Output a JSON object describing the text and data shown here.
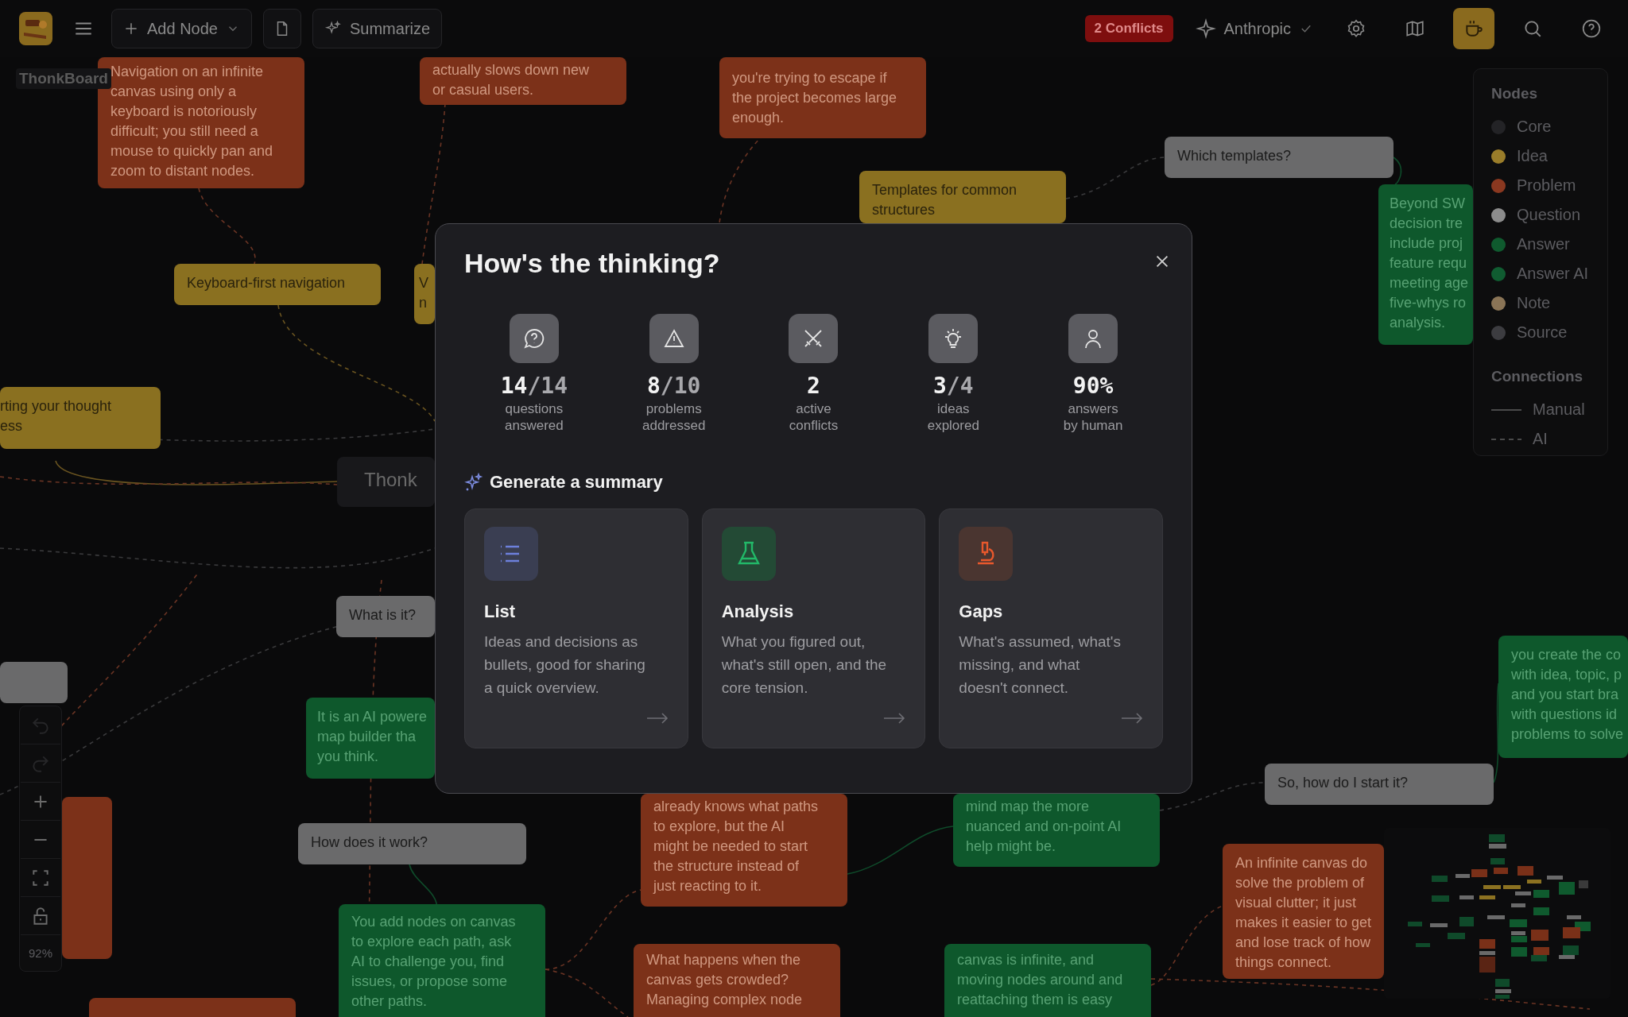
{
  "top_bar": {
    "add_node": "Add Node",
    "summarize": "Summarize",
    "conflicts": "2 Conflicts",
    "provider": "Anthropic",
    "tools": [
      {
        "kind": "settings",
        "selected": false
      },
      {
        "kind": "map",
        "selected": false
      },
      {
        "kind": "coffee",
        "selected": true
      },
      {
        "kind": "search",
        "selected": false
      },
      {
        "kind": "help",
        "selected": false
      }
    ]
  },
  "board_title": "ThonkBoard",
  "nodes": [
    {
      "kind": "problem",
      "text": "Navigation on an infinite\ncanvas using only a\nkeyboard is notoriously\ndifficult; you still need a\nmouse to quickly pan and\nzoom to distant nodes."
    },
    {
      "kind": "problem",
      "text": "actually slows down new\nor casual users."
    },
    {
      "kind": "problem",
      "text": "you're trying to escape if\nthe project becomes large\nenough."
    },
    {
      "kind": "idea",
      "text": "Keyboard-first navigation"
    },
    {
      "kind": "idea",
      "text": "V\nn"
    },
    {
      "kind": "idea",
      "text": "rting your thought\ness"
    },
    {
      "kind": "core",
      "text": "Thonk"
    },
    {
      "kind": "idea",
      "text": "Templates for common\nstructures"
    },
    {
      "kind": "question",
      "text": "Which templates?"
    },
    {
      "kind": "answer",
      "text": "Beyond SW\ndecision tre\ninclude proj\nfeature requ\nmeeting age\nfive-whys ro\nanalysis."
    },
    {
      "kind": "question",
      "text": "What is it?"
    },
    {
      "kind": "question"
    },
    {
      "kind": "answer",
      "text": "It is an AI powere\nmap builder tha\nyou think."
    },
    {
      "kind": "problem"
    },
    {
      "kind": "question",
      "text": "How does it work?"
    },
    {
      "kind": "answer",
      "text": "You add nodes on canvas\nto explore each path, ask\nAI to challenge you, find\nissues, or propose some\nother paths."
    },
    {
      "kind": "problem"
    },
    {
      "kind": "problem",
      "text": "already knows what paths\nto explore, but the AI\nmight be needed to start\nthe structure instead of\njust reacting to it."
    },
    {
      "kind": "problem",
      "text": "What happens when the\ncanvas gets crowded?\nManaging complex node"
    },
    {
      "kind": "answer",
      "text": "mind map the more\nnuanced and on-point AI\nhelp might be."
    },
    {
      "kind": "answer",
      "text": "canvas is infinite, and\nmoving nodes around and\nreattaching them is easy"
    },
    {
      "kind": "question",
      "text": "So, how do I start it?"
    },
    {
      "kind": "answer",
      "text": "you create the co\nwith idea, topic, p\nand you start bra\nwith questions id\nproblems to solve"
    },
    {
      "kind": "problem",
      "text": "An infinite canvas do\nsolve the problem of\nvisual clutter; it just\nmakes it easier to get\nand lose track of how\nthings connect."
    }
  ],
  "legend": {
    "nodes_title": "Nodes",
    "node_types": [
      {
        "label": "Core",
        "color": "#232326"
      },
      {
        "label": "Idea",
        "color": "#9a7d2a"
      },
      {
        "label": "Problem",
        "color": "#8a3820"
      },
      {
        "label": "Question",
        "color": "#8c8c8c"
      },
      {
        "label": "Answer",
        "color": "#0f5a2e"
      },
      {
        "label": "Answer AI",
        "color": "#105c31"
      },
      {
        "label": "Note",
        "color": "#8a7456"
      },
      {
        "label": "Source",
        "color": "#3c3c40"
      }
    ],
    "connections_title": "Connections",
    "connection_types": [
      {
        "label": "Manual",
        "kind": "solid"
      },
      {
        "label": "AI",
        "kind": "dashed"
      }
    ]
  },
  "zoom_controls": {
    "buttons": [
      {
        "kind": "undo",
        "disabled": true
      },
      {
        "kind": "redo",
        "disabled": true
      },
      {
        "kind": "zoom-in",
        "disabled": false
      },
      {
        "kind": "zoom-out",
        "disabled": false
      },
      {
        "kind": "fit",
        "disabled": false
      },
      {
        "kind": "lock",
        "disabled": false
      }
    ],
    "zoom": "92%"
  },
  "dialog": {
    "title": "How's the thinking?",
    "stats": [
      {
        "kind": "question",
        "value": "14",
        "total": "/14",
        "label": "questions\nanswered"
      },
      {
        "kind": "problem",
        "value": "8",
        "total": "/10",
        "label": "problems\naddressed"
      },
      {
        "kind": "conflict",
        "value": "2",
        "label": "active\nconflicts"
      },
      {
        "kind": "idea",
        "value": "3",
        "total": "/4",
        "label": "ideas\nexplored"
      },
      {
        "kind": "human",
        "value": "90%",
        "label": "answers\nby human"
      }
    ],
    "summary_heading": "Generate a summary",
    "options": [
      {
        "kind": "list",
        "title": "List",
        "description": "Ideas and decisions as\nbullets, good for sharing\na quick overview."
      },
      {
        "kind": "analysis",
        "title": "Analysis",
        "description": "What you figured out,\nwhat's still open, and the\ncore tension."
      },
      {
        "kind": "gaps",
        "title": "Gaps",
        "description": "What's assumed, what's\nmissing, and what\ndoesn't connect."
      }
    ]
  }
}
